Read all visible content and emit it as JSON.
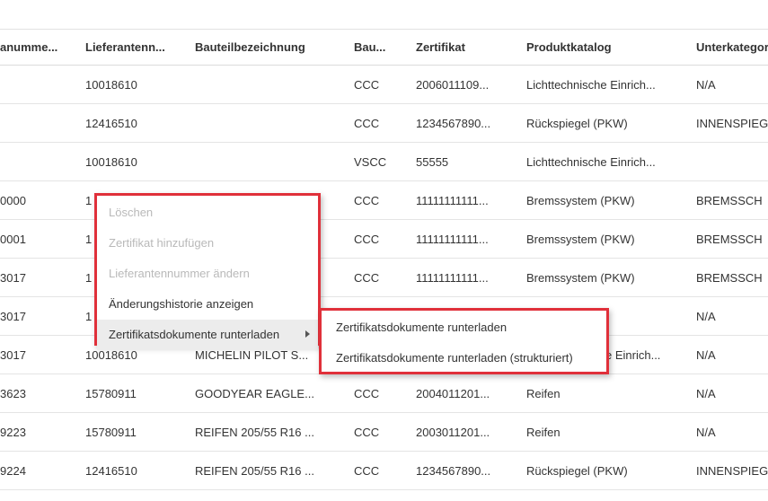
{
  "table": {
    "headers": [
      "anumme...",
      "Lieferantenn...",
      "Bauteilbezeichnung",
      "Bau...",
      "Zertifikat",
      "Produktkatalog",
      "Unterkategor"
    ],
    "rows": [
      [
        "",
        "10018610",
        "",
        "CCC",
        "2006011109...",
        "Lichttechnische Einrich...",
        "N/A"
      ],
      [
        "",
        "12416510",
        "",
        "CCC",
        "1234567890...",
        "Rückspiegel (PKW)",
        "INNENSPIEG"
      ],
      [
        "",
        "10018610",
        "",
        "VSCC",
        "55555",
        "Lichttechnische Einrich...",
        ""
      ],
      [
        "0000",
        "1",
        "",
        "CCC",
        "11111111111...",
        "Bremssystem (PKW)",
        "BREMSSCH"
      ],
      [
        "0001",
        "1",
        "",
        "CCC",
        "11111111111...",
        "Bremssystem (PKW)",
        "BREMSSCH"
      ],
      [
        "3017",
        "1",
        "",
        "CCC",
        "11111111111...",
        "Bremssystem (PKW)",
        "BREMSSCH"
      ],
      [
        "3017",
        "1",
        "",
        "",
        "",
        "",
        "N/A"
      ],
      [
        "3017",
        "10018610",
        "MICHELIN PILOT S...",
        "",
        "",
        "e Einrich...",
        "N/A"
      ],
      [
        "3623",
        "15780911",
        "GOODYEAR EAGLE...",
        "CCC",
        "2004011201...",
        "Reifen",
        "N/A"
      ],
      [
        "9223",
        "15780911",
        "REIFEN 205/55 R16 ...",
        "CCC",
        "2003011201...",
        "Reifen",
        "N/A"
      ],
      [
        "9224",
        "12416510",
        "REIFEN 205/55 R16 ...",
        "CCC",
        "1234567890...",
        "Rückspiegel (PKW)",
        "INNENSPIEG"
      ]
    ]
  },
  "context_menu": {
    "items": [
      {
        "label": "Löschen",
        "enabled": false
      },
      {
        "label": "Zertifikat hinzufügen",
        "enabled": false
      },
      {
        "label": "Lieferantennummer ändern",
        "enabled": false
      },
      {
        "label": "Änderungshistorie anzeigen",
        "enabled": true
      },
      {
        "label": "Zertifikatsdokumente runterladen",
        "enabled": true,
        "has_submenu": true,
        "icon": "chevron-right-icon"
      }
    ],
    "highlight_color": "#e0303a"
  },
  "submenu": {
    "items": [
      {
        "label": "Zertifikatsdokumente runterladen"
      },
      {
        "label": "Zertifikatsdokumente runterladen (strukturiert)"
      }
    ]
  }
}
